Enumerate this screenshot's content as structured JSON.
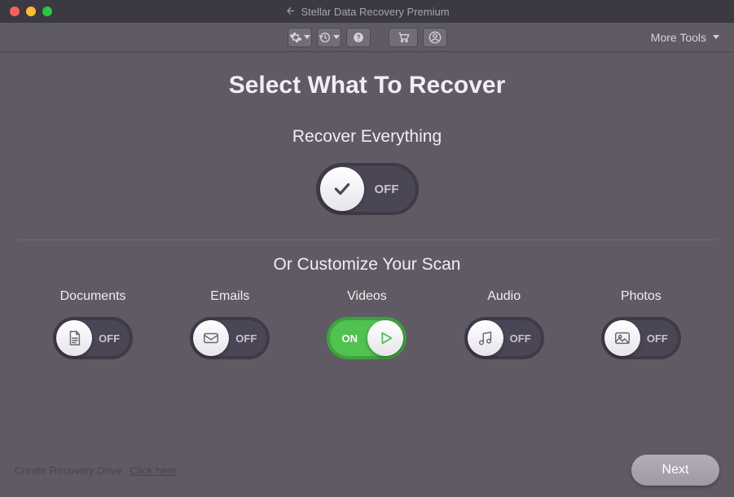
{
  "titlebar": {
    "title": "Stellar Data Recovery Premium"
  },
  "toolbar": {
    "more_tools": "More Tools"
  },
  "headings": {
    "main": "Select What To Recover",
    "recover_all": "Recover Everything",
    "customize": "Or Customize Your Scan"
  },
  "toggles": {
    "all": {
      "state": "OFF",
      "on": false
    },
    "documents": {
      "label": "Documents",
      "state": "OFF",
      "on": false
    },
    "emails": {
      "label": "Emails",
      "state": "OFF",
      "on": false
    },
    "videos": {
      "label": "Videos",
      "state": "ON",
      "on": true
    },
    "audio": {
      "label": "Audio",
      "state": "OFF",
      "on": false
    },
    "photos": {
      "label": "Photos",
      "state": "OFF",
      "on": false
    }
  },
  "footer": {
    "create_drive": "Create Recovery Drive",
    "click_here": "Click here",
    "next": "Next"
  }
}
